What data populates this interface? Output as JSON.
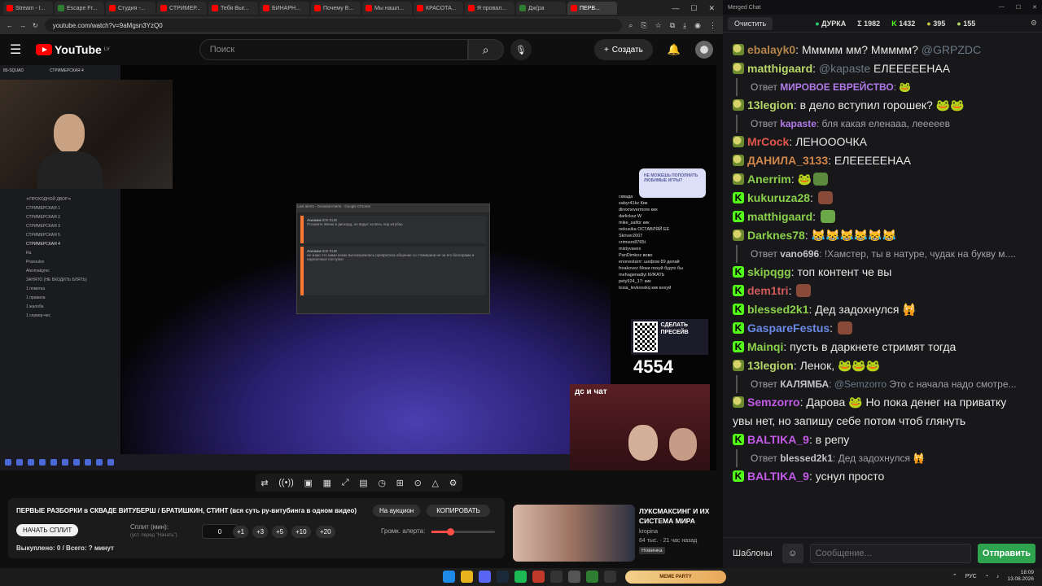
{
  "browser": {
    "tabs": [
      {
        "label": "Stream - I...",
        "kind": "yt"
      },
      {
        "label": "Escape Fr...",
        "kind": "g"
      },
      {
        "label": "Студия -...",
        "kind": "yt"
      },
      {
        "label": "СТРИМЕР...",
        "kind": "yt"
      },
      {
        "label": "Тебя Выг...",
        "kind": "yt"
      },
      {
        "label": "БИНАРН...",
        "kind": "yt"
      },
      {
        "label": "Почему В...",
        "kind": "yt"
      },
      {
        "label": "Мы нашл...",
        "kind": "yt"
      },
      {
        "label": "КРАСОТА...",
        "kind": "yt"
      },
      {
        "label": "Я провал...",
        "kind": "yt"
      },
      {
        "label": "Дж(ра",
        "kind": "g"
      },
      {
        "label": "ПЕРВ...",
        "kind": "yt",
        "active": true
      }
    ],
    "url": "youtube.com/watch?v=9aMgsn3YzQ0"
  },
  "youtube": {
    "logo_text": "YouTube",
    "logo_region": "LV",
    "search_placeholder": "Поиск",
    "create_label": "Создать"
  },
  "stream": {
    "discord_top": "89-SQUAD",
    "discord_channel": "СТРИМЕРСКАЯ 4",
    "discord_lines": [
      "✕ПРОХОДНОЙ ДВОР✕",
      "СТРИМЕРСКАЯ 1",
      "СТРИМЕРСКАЯ 2",
      "СТРИМЕРСКАЯ 3",
      "СТРИМЕРСКАЯ 5",
      "СТРИМЕРСКАЯ 4",
      "Ra",
      "Pravoulov",
      "Alexmakgrec",
      "ЗАНЯТО (НЕ ВХОДИТЬ БЛЯТЬ)",
      "1 пометка",
      "1 правила",
      "1 жалоба",
      "1 сервер-чес"
    ],
    "alerts_title": "Last alerts - DonationAlerts - Google Chrome",
    "alert_1_user": "Аноним",
    "alert_1_amount": "500 RUB",
    "alert_1_text": "Позовите Женю в дискорд, он видит за весь пор ютубер",
    "alert_2_user": "Аноним",
    "alert_2_amount": "500 RUB",
    "alert_2_text": "не знаю что ними некак высказывались превратила общение со стамерани не за его блогерами и нарезочные поступки",
    "sticker_text": "НЕ МОЖЕШЬ ПОПОЛНИТЬ ЛЮБИМЫЕ ИГРЫ?",
    "overlay_chat": [
      "сквада",
      "sabyr41kz Кик",
      "direxnevermore кик",
      "darlicksz W",
      "mike_saifor кик",
      "nekusika ОСТАВЛЯЙ ЕЕ",
      "Skriver2007",
      "crimson8765t",
      "mistyvavex",
      "PanDimkoz вово",
      "enonestarrr: шефом 89 делай",
      "freakovez Моки похуй будто бы",
      "mehagenadiyi КИКАТЬ",
      "pety924_17: кик",
      "tosia_levkovskq кик внхуй"
    ],
    "qr_text": "СДЕЛАТЬ ПРЕСЕЙВ",
    "counter": "4554",
    "ds_label": "дс и чат",
    "taskbar_icons": 10
  },
  "player_controls": [
    "⇄",
    "((•))",
    "▣",
    "▦",
    "⤢",
    "▤",
    "◷",
    "⊞",
    "⊙",
    "△",
    "⚙"
  ],
  "panel": {
    "title": "ПЕРВЫЕ РАЗБОРКИ в СКВАДЕ ВИТУБЕРШ / БРАТИШКИН, СТИНТ (вся суть ру-витубинга в одном видео)",
    "auction": "На аукцион",
    "copy": "КОПИРОВАТЬ",
    "start_split": "НАЧАТЬ СПЛИТ",
    "split_label": "Сплит (мин):",
    "split_hint": "(уст. перед \"Начать\")",
    "split_value": "0",
    "steps": [
      "+1",
      "+3",
      "+5",
      "+10",
      "+20"
    ],
    "volume_label": "Громк. алерта:",
    "volume_level": 0.3,
    "bought": "Выкуплено: 0 / Всего: ? минут"
  },
  "recommended": {
    "title": "ЛУКСМАКСИНГ И ИХ СИСТЕМА МИРА",
    "channel": "kropina",
    "meta": "64 тыс. · 21 час назад",
    "badge": "Новинка",
    "duration": "1:17:04"
  },
  "chat": {
    "window_title": "Merged Chat",
    "clear_label": "Очистить",
    "channel": "ДУРКА",
    "stat_sum": "Σ 1982",
    "stat_kick": "1432",
    "stat_pepe": "395",
    "stat_other": "155",
    "messages": [
      {
        "type": "msg",
        "badge": "pepe",
        "user": "ebalayk0",
        "color": "#b3854a",
        "text": "Ммммм мм? Ммммм? ",
        "mention": "@GRPZDC"
      },
      {
        "type": "msg",
        "badge": "pepe",
        "user": "matthigaard",
        "color": "#b9d86a",
        "text": "",
        "mention": "@kapaste",
        "after": " ЕЛЕЕЕЕЕНАА"
      },
      {
        "type": "reply",
        "prefix": "Ответ ",
        "user": "МИРОВОЕ ЕВРЕЙСТВО",
        "color": "#b07ae8",
        "text": ": 🐸"
      },
      {
        "type": "msg",
        "badge": "pepe",
        "user": "13legion",
        "color": "#b9d86a",
        "text": "в дело вступил горошек? 🐸🐸"
      },
      {
        "type": "reply",
        "prefix": "Ответ ",
        "user": "kapaste",
        "color": "#b07ae8",
        "text": ": бля какая еленааа, лееееев"
      },
      {
        "type": "msg",
        "badge": "pepe",
        "user": "MrCock",
        "color": "#e0564a",
        "text": "ЛЕНОООЧКА"
      },
      {
        "type": "msg",
        "badge": "pepe",
        "user": "ДАНИЛА_3133",
        "color": "#d0864a",
        "text": "ЕЛЕЕЕЕЕНАА"
      },
      {
        "type": "msg",
        "badge": "pepe",
        "user": "Anerrim",
        "color": "#8ad04a",
        "text": "🐸",
        "emote": "#5a8a3a"
      },
      {
        "type": "msg",
        "badge": "kick",
        "user": "kukuruza28",
        "color": "#8ad04a",
        "text": "",
        "emote": "#8a4a3a"
      },
      {
        "type": "msg",
        "badge": "kick",
        "user": "matthigaard",
        "color": "#8ad04a",
        "text": "",
        "emote": "#6aa84a"
      },
      {
        "type": "msg",
        "badge": "pepe",
        "user": "Darknes78",
        "color": "#8ad04a",
        "text": "😹😹😹😹😹😹"
      },
      {
        "type": "reply",
        "prefix": "Ответ ",
        "user": "vano696",
        "color": "#c0c0c8",
        "text": ": !Хамстер, ты в натуре, чудак на букву м...."
      },
      {
        "type": "msg",
        "badge": "kick",
        "user": "skipqgg",
        "color": "#8ad04a",
        "text": "топ контент че вы"
      },
      {
        "type": "msg",
        "badge": "kick",
        "user": "dem1tri",
        "color": "#d05a5a",
        "text": "",
        "emote": "#8a4a3a"
      },
      {
        "type": "msg",
        "badge": "kick",
        "user": "blessed2k1",
        "color": "#8ad04a",
        "text": "Дед задохнулся 🙀"
      },
      {
        "type": "msg",
        "badge": "kick",
        "user": "GaspareFestus",
        "color": "#6a8ae8",
        "text": "",
        "emote": "#8a4a3a"
      },
      {
        "type": "msg",
        "badge": "kick",
        "user": "Mainqi",
        "color": "#8ad04a",
        "text": "пусть в даркнете стримят тогда"
      },
      {
        "type": "msg",
        "badge": "pepe",
        "user": "13legion",
        "color": "#b9d86a",
        "text": "Ленок, 🐸🐸🐸"
      },
      {
        "type": "reply",
        "prefix": "Ответ ",
        "user": "КАЛЯМБА",
        "color": "#c0c0c8",
        "text": ": ",
        "mention": "@Semzorro",
        "after": " Это с начала надо смотре..."
      },
      {
        "type": "msg",
        "badge": "pepe",
        "user": "Semzorro",
        "color": "#c45ae8",
        "text": "Дарова 🐸 Но пока денег на приватку"
      },
      {
        "type": "cont",
        "text": "увы нет, но запишу себе потом чтоб глянуть"
      },
      {
        "type": "msg",
        "badge": "kick",
        "user": "BALTIKA_9",
        "color": "#c45ae8",
        "text": "в репу"
      },
      {
        "type": "reply",
        "prefix": "Ответ ",
        "user": "blessed2k1",
        "color": "#c0c0c8",
        "text": ": Дед задохнулся 🙀"
      },
      {
        "type": "msg",
        "badge": "kick",
        "user": "BALTIKA_9",
        "color": "#c45ae8",
        "text": "уснул просто"
      }
    ],
    "templates_label": "Шаблоны",
    "input_placeholder": "Сообщение...",
    "send_label": "Отправить"
  },
  "taskbar": {
    "game_badge": "MEME PARTY",
    "lang": "РУС",
    "time": "18:09",
    "date": "13.08.2026"
  }
}
